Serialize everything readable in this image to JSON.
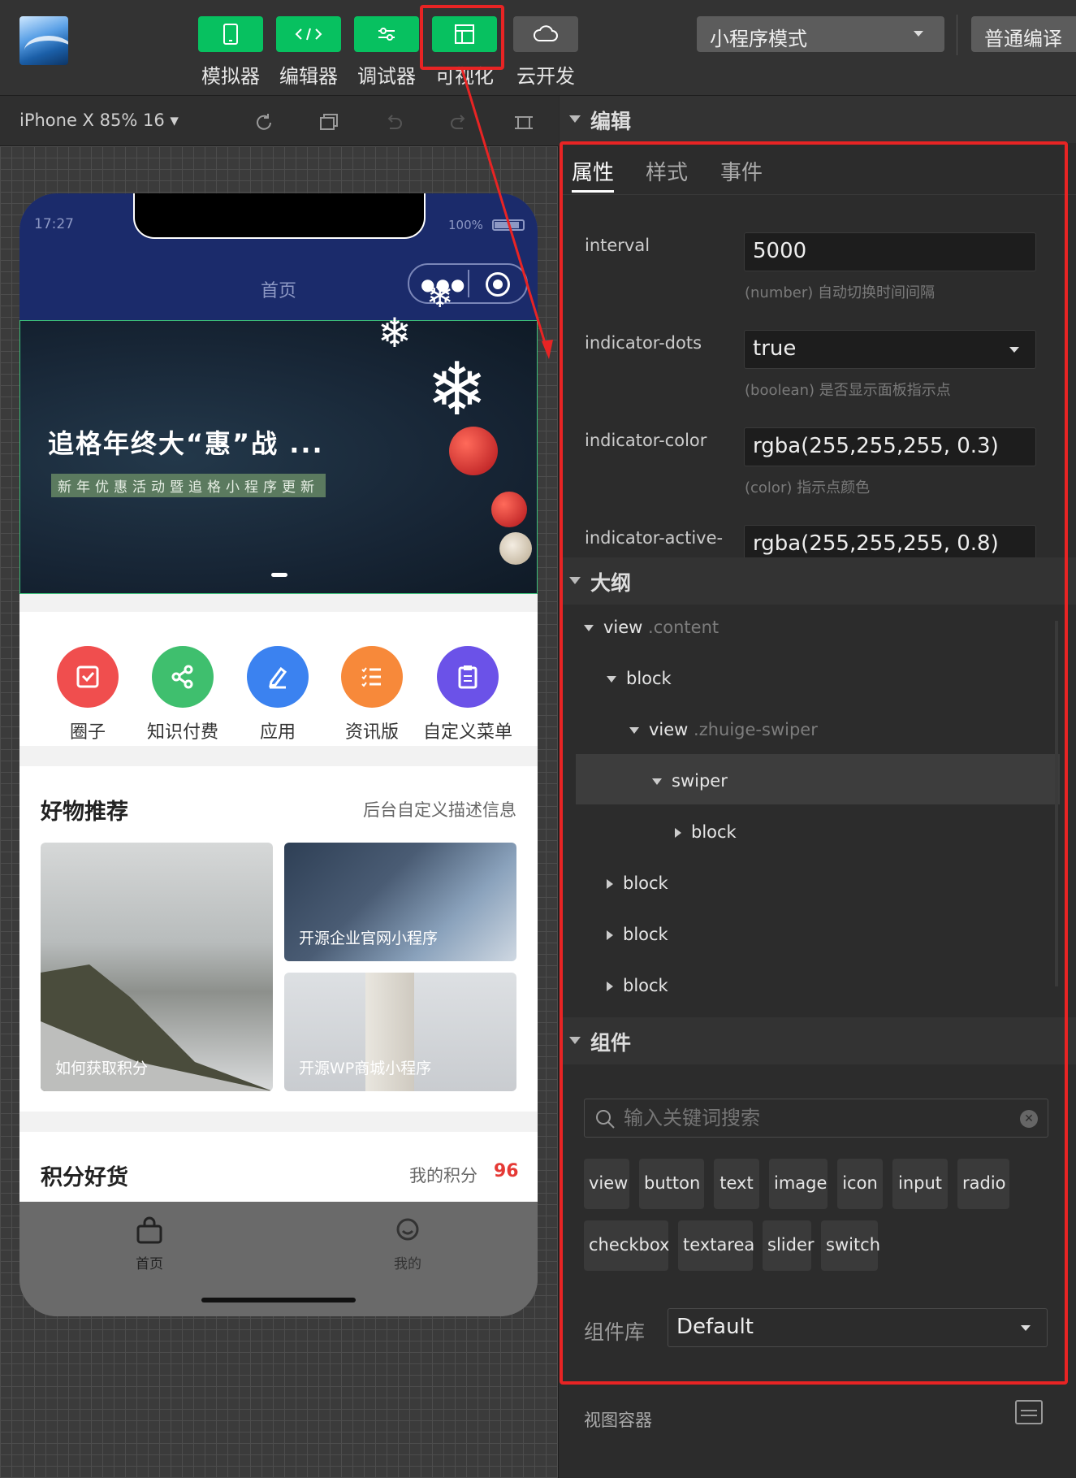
{
  "toolbar": {
    "buttons": [
      {
        "label": "模拟器",
        "icon": "phone-icon"
      },
      {
        "label": "编辑器",
        "icon": "code-icon"
      },
      {
        "label": "调试器",
        "icon": "sliders-icon"
      },
      {
        "label": "可视化",
        "icon": "layout-icon"
      },
      {
        "label": "云开发",
        "icon": "cloud-icon"
      }
    ],
    "mode_select": "小程序模式",
    "compile_button": "普通编译"
  },
  "simulator": {
    "device_select": "iPhone X 85% 16 ▾"
  },
  "phone": {
    "time": "17:27",
    "battery": "100%",
    "nav_title": "首页",
    "banner": {
      "title": "追格年终大“惠”战 ...",
      "subtitle": "新年优惠活动暨追格小程序更新"
    },
    "menu": [
      {
        "label": "圈子",
        "color": "#f04e4e"
      },
      {
        "label": "知识付费",
        "color": "#3fbf6e"
      },
      {
        "label": "应用",
        "color": "#3b82f0"
      },
      {
        "label": "资讯版",
        "color": "#f7893a"
      },
      {
        "label": "自定义菜单",
        "color": "#6b52e8"
      }
    ],
    "goods_section": {
      "title": "好物推荐",
      "desc": "后台自定义描述信息",
      "cards": [
        {
          "caption": "如何获取积分"
        },
        {
          "caption": "开源企业官网小程序"
        },
        {
          "caption": "开源WP商城小程序"
        }
      ]
    },
    "points_section": {
      "title": "积分好货",
      "label": "我的积分",
      "value": "96"
    },
    "tabbar": [
      {
        "label": "首页",
        "icon": "home-bag-icon"
      },
      {
        "label": "我的",
        "icon": "user-icon"
      }
    ]
  },
  "panel": {
    "edit_header": "编辑",
    "tabs": [
      "属性",
      "样式",
      "事件"
    ],
    "properties": [
      {
        "name": "interval",
        "value": "5000",
        "hint": "(number) 自动切换时间间隔"
      },
      {
        "name": "indicator-dots",
        "value": "true",
        "hint": "(boolean) 是否显示面板指示点"
      },
      {
        "name": "indicator-color",
        "value": "rgba(255,255,255, 0.3)",
        "hint": "(color) 指示点颜色"
      },
      {
        "name": "indicator-active-",
        "value": "rgba(255,255,255, 0.8)",
        "hint": ""
      }
    ],
    "outline_header": "大纲",
    "outline": [
      {
        "tag": "view",
        "cls": ".content",
        "depth": 0,
        "open": true
      },
      {
        "tag": "block",
        "cls": "",
        "depth": 1,
        "open": true
      },
      {
        "tag": "view",
        "cls": ".zhuige-swiper",
        "depth": 2,
        "open": true
      },
      {
        "tag": "swiper",
        "cls": "",
        "depth": 3,
        "open": true
      },
      {
        "tag": "block",
        "cls": "",
        "depth": 4,
        "open": false
      },
      {
        "tag": "block",
        "cls": "",
        "depth": 1,
        "open": false
      },
      {
        "tag": "block",
        "cls": "",
        "depth": 1,
        "open": false
      },
      {
        "tag": "block",
        "cls": "",
        "depth": 1,
        "open": false
      }
    ],
    "components_header": "组件",
    "search_placeholder": "输入关键词搜索",
    "components": [
      "view",
      "button",
      "text",
      "image",
      "icon",
      "input",
      "radio",
      "checkbox",
      "textarea",
      "slider",
      "switch"
    ],
    "library_label": "组件库",
    "library_value": "Default",
    "footer_label": "视图容器"
  },
  "colors": {
    "accent_green": "#07c160",
    "highlight_red": "#e82424",
    "points_red": "#e53935"
  }
}
